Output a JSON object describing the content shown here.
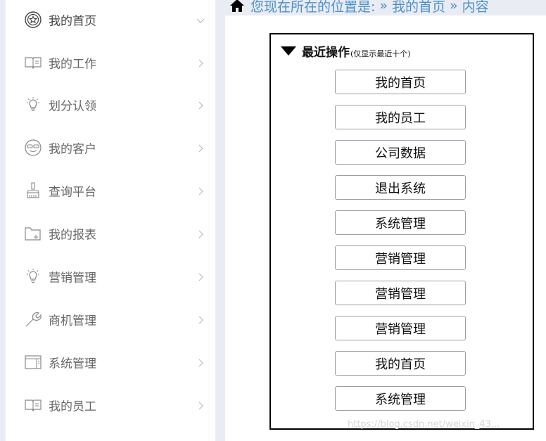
{
  "sidebar": {
    "items": [
      {
        "label": "我的首页",
        "icon": "star-badge-icon",
        "chevron": "chevron-down-icon"
      },
      {
        "label": "我的工作",
        "icon": "book-icon",
        "chevron": "chevron-right-icon"
      },
      {
        "label": "划分认领",
        "icon": "lightbulb-icon",
        "chevron": "chevron-right-icon"
      },
      {
        "label": "我的客户",
        "icon": "customer-face-icon",
        "chevron": "chevron-right-icon"
      },
      {
        "label": "查询平台",
        "icon": "brush-icon",
        "chevron": "chevron-right-icon"
      },
      {
        "label": "我的报表",
        "icon": "folder-add-icon",
        "chevron": "chevron-right-icon"
      },
      {
        "label": "营销管理",
        "icon": "lightbulb-icon",
        "chevron": "chevron-right-icon"
      },
      {
        "label": "商机管理",
        "icon": "wrench-icon",
        "chevron": "chevron-right-icon"
      },
      {
        "label": "系统管理",
        "icon": "window-icon",
        "chevron": "chevron-right-icon"
      },
      {
        "label": "我的员工",
        "icon": "book-icon",
        "chevron": "chevron-right-icon"
      }
    ]
  },
  "breadcrumb": {
    "prefix": "您现在所在的位置是:",
    "sep1": "»",
    "crumb1": "我的首页",
    "sep2": "»",
    "crumb2": "内容"
  },
  "panel": {
    "title": "最近操作",
    "subtitle": "(仅显示最近十个)",
    "buttons": [
      "我的首页",
      "我的员工",
      "公司数据",
      "退出系统",
      "系统管理",
      "营销管理",
      "营销管理",
      "营销管理",
      "我的首页",
      "系统管理"
    ]
  },
  "watermark": "https://blog.csdn.net/weixin_43...",
  "colors": {
    "accent": "#4a90c8",
    "sidebar_text": "#666666",
    "background": "#e9ecf3"
  }
}
